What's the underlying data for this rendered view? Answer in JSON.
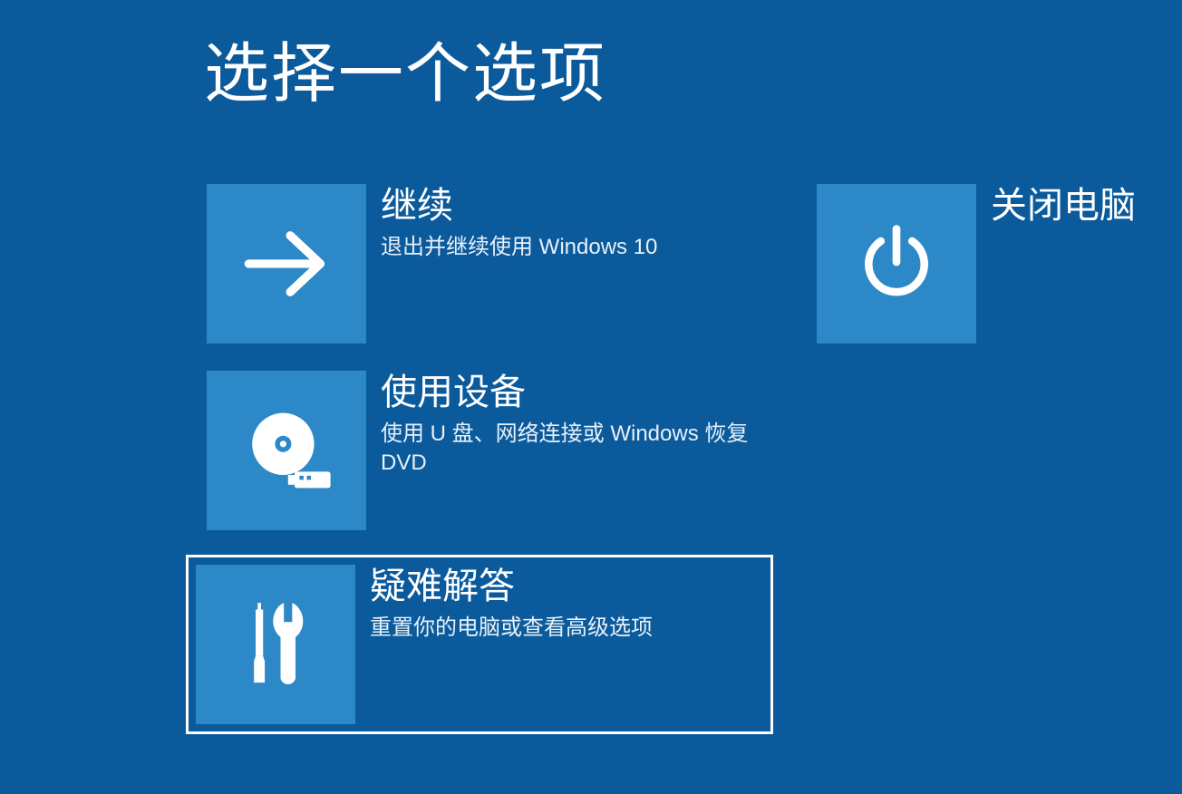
{
  "page": {
    "title": "选择一个选项"
  },
  "options": {
    "continue": {
      "title": "继续",
      "desc": "退出并继续使用 Windows 10"
    },
    "use_device": {
      "title": "使用设备",
      "desc": "使用 U 盘、网络连接或 Windows 恢复 DVD"
    },
    "troubleshoot": {
      "title": "疑难解答",
      "desc": "重置你的电脑或查看高级选项"
    },
    "shutdown": {
      "title": "关闭电脑"
    }
  }
}
